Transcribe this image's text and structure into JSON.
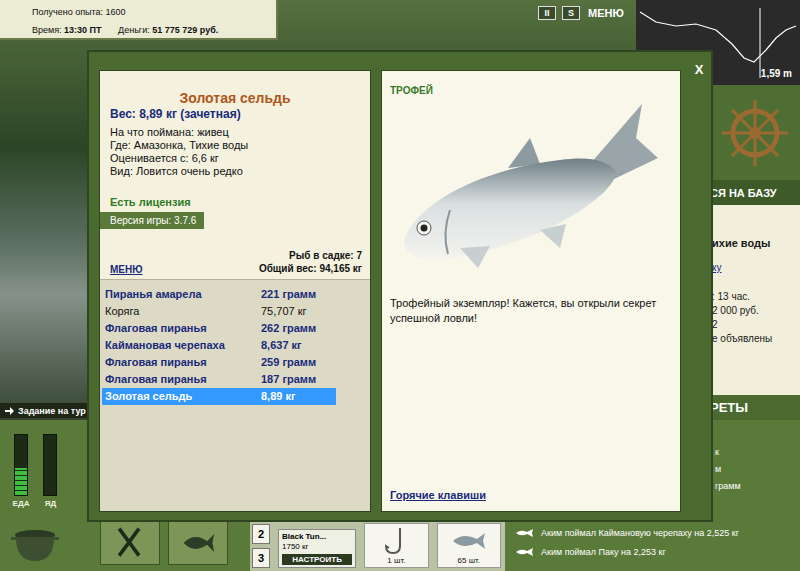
{
  "hud": {
    "experience": "Получено опыта: 1600",
    "time_label": "Время:",
    "time": "13:30 ПТ",
    "money_label": "Деньги:",
    "money": "51 775 729 руб."
  },
  "top_buttons": [
    {
      "label": "II",
      "kind": "icon"
    },
    {
      "label": "S",
      "kind": "icon"
    },
    {
      "label": "МЕНЮ",
      "kind": "menu"
    }
  ],
  "minimap": {
    "depth": "1,59 m"
  },
  "task": "Задание на тур",
  "sidebar": {
    "return_button": "СЯ НА БАЗУ",
    "place": "ихие воды",
    "link": "ку",
    "lines": [
      ": 13 час.",
      "2 000 руб.",
      "2",
      "е объявлены"
    ],
    "records_title": "РЕТЫ"
  },
  "meters": [
    {
      "label": "ЕДА",
      "level": 0.45
    },
    {
      "label": "ЯД",
      "level": 0
    }
  ],
  "slots": [
    "2",
    "3"
  ],
  "tackle": {
    "name": "Black Tun...",
    "weight": "1750 кг",
    "button": "НАСТРОИТЬ"
  },
  "items": [
    {
      "count": "1 шт.",
      "kind": "hook"
    },
    {
      "count": "65 шт.",
      "kind": "bait"
    }
  ],
  "records_fragments": [
    "к",
    "м",
    "грамм"
  ],
  "records": [
    "Аким поймал Каймановую черепаху на 2,525 кг",
    "Аким поймал Паку на 2,253 кг"
  ],
  "dialog": {
    "close": "X",
    "catch": {
      "title": "Золотая сельдь",
      "weight": "Вес: 8,89 кг (зачетная)",
      "lines": [
        "На что поймана: живец",
        "Где: Амазонка, Тихие воды",
        "Оценивается с: 6,6 кг",
        "Вид: Ловится очень редко"
      ]
    },
    "license": "Есть лицензия",
    "version": "Версия игры: 3.7.6",
    "menu": "МЕНЮ",
    "keepnet_count": "Рыб в садке: 7",
    "keepnet_weight": "Общий вес: 94,165 кг",
    "catches": [
      {
        "name": "Пиранья амарела",
        "weight": "221 грамм",
        "kind": "fish",
        "selected": false
      },
      {
        "name": "Коряга",
        "weight": "75,707 кг",
        "kind": "junk",
        "selected": false
      },
      {
        "name": "Флаговая пиранья",
        "weight": "262 грамм",
        "kind": "fish",
        "selected": false
      },
      {
        "name": "Каймановая черепаха",
        "weight": "8,637 кг",
        "kind": "fish",
        "selected": false
      },
      {
        "name": "Флаговая пиранья",
        "weight": "259 грамм",
        "kind": "fish",
        "selected": false
      },
      {
        "name": "Флаговая пиранья",
        "weight": "187 грамм",
        "kind": "fish",
        "selected": false
      },
      {
        "name": "Золотая сельдь",
        "weight": "8,89 кг",
        "kind": "fish",
        "selected": true
      }
    ],
    "trophy": {
      "title": "ТРОФЕЙ",
      "message": "Трофейный экземпляр! Кажется, вы открыли секрет успешной ловли!",
      "hotkeys": "Горячие клавиши"
    }
  }
}
